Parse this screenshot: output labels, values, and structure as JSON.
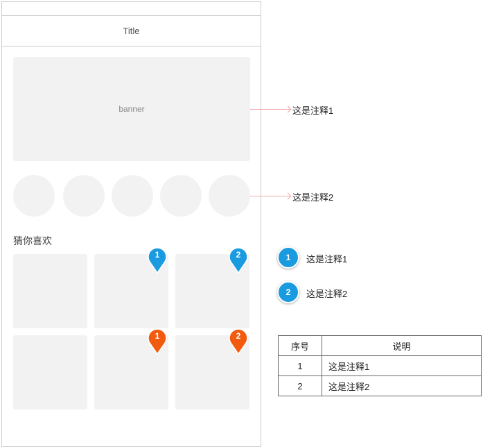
{
  "screen": {
    "title": "Title",
    "banner_label": "banner",
    "section_title": "猜你喜欢"
  },
  "pins": {
    "blue_1": "1",
    "blue_2": "2",
    "orange_1": "1",
    "orange_2": "2"
  },
  "annotations": {
    "arrow_note_1": "这是注释1",
    "arrow_note_2": "这是注释2",
    "badge_list": [
      {
        "number": "1",
        "text": "这是注释1"
      },
      {
        "number": "2",
        "text": "这是注释2"
      }
    ]
  },
  "legend_table": {
    "headers": {
      "number": "序号",
      "description": "说明"
    },
    "rows": [
      {
        "number": "1",
        "description": "这是注释1"
      },
      {
        "number": "2",
        "description": "这是注释2"
      }
    ]
  },
  "colors": {
    "pin_blue": "#1a9be0",
    "pin_orange": "#f25a0f",
    "placeholder": "#f2f2f2",
    "arrow": "#f0a8a8"
  }
}
